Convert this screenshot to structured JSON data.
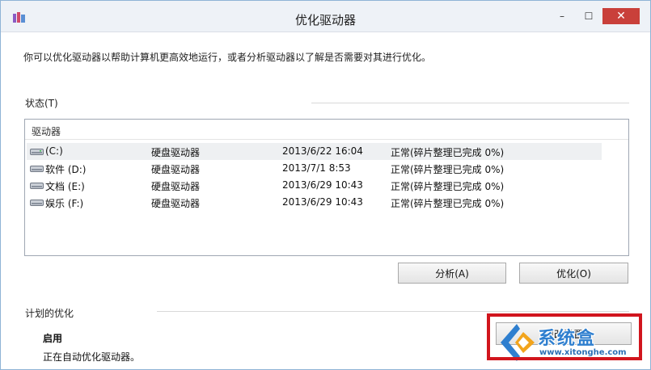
{
  "window": {
    "title": "优化驱动器",
    "controls": {
      "minimize": "–",
      "maximize": "☐",
      "close": "✕"
    }
  },
  "intro_text": "你可以优化驱动器以帮助计算机更高效地运行，或者分析驱动器以了解是否需要对其进行优化。",
  "status": {
    "label": "状态(T)",
    "column_header": "驱动器",
    "rows": [
      {
        "name": "(C:)",
        "type": "硬盘驱动器",
        "last_run": "2013/6/22 16:04",
        "status": "正常(碎片整理已完成 0%)",
        "selected": true
      },
      {
        "name": "软件 (D:)",
        "type": "硬盘驱动器",
        "last_run": "2013/7/1 8:53",
        "status": "正常(碎片整理已完成 0%)",
        "selected": false
      },
      {
        "name": "文档 (E:)",
        "type": "硬盘驱动器",
        "last_run": "2013/6/29 10:43",
        "status": "正常(碎片整理已完成 0%)",
        "selected": false
      },
      {
        "name": "娱乐 (F:)",
        "type": "硬盘驱动器",
        "last_run": "2013/6/29 10:43",
        "status": "正常(碎片整理已完成 0%)",
        "selected": false
      }
    ]
  },
  "actions": {
    "analyze_label": "分析(A)",
    "optimize_label": "优化(O)"
  },
  "scheduled": {
    "label": "计划的优化",
    "state": "启用",
    "description": "正在自动优化驱动器。",
    "change_button_label": "更改设置"
  },
  "watermark": {
    "name": "系统盒",
    "url": "www.xitonghe.com"
  },
  "colors": {
    "highlight": "#d1151d",
    "close_button": "#c9403a",
    "watermark": "#2f7fcf"
  },
  "icons": {
    "app": "defrag-app-icon",
    "drive": "hard-drive-icon"
  }
}
